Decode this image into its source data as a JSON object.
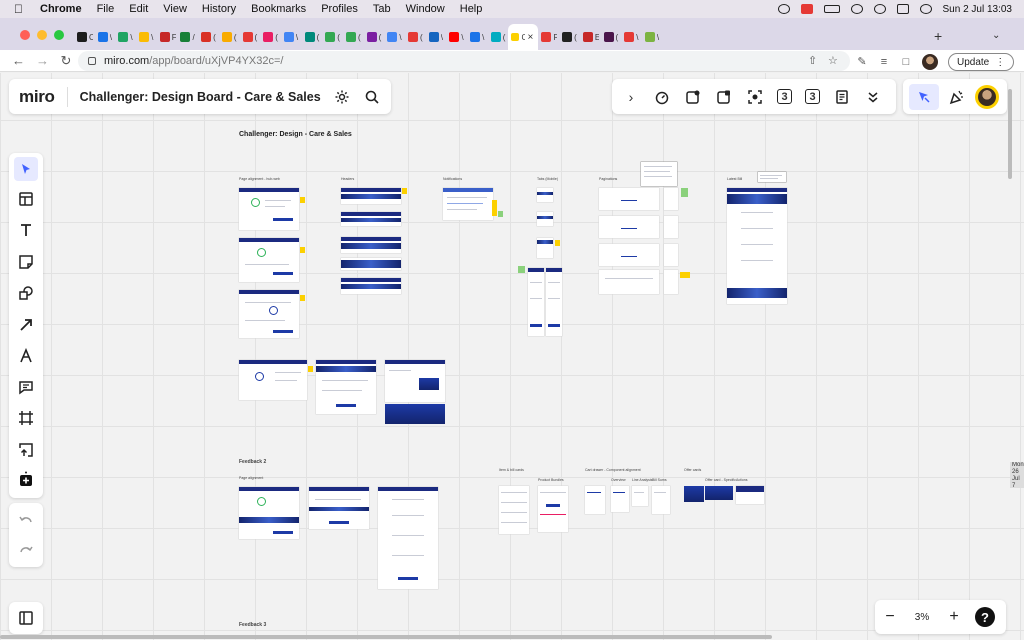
{
  "menubar": {
    "app": "Chrome",
    "items": [
      "File",
      "Edit",
      "View",
      "History",
      "Bookmarks",
      "Profiles",
      "Tab",
      "Window",
      "Help"
    ],
    "datetime": "Sun 2 Jul  13:03"
  },
  "tabs": [
    {
      "label": "O",
      "color": "#1d1d1d"
    },
    {
      "label": "\\",
      "color": "#1a73e8"
    },
    {
      "label": "\\",
      "color": "#1fa463"
    },
    {
      "label": "\\",
      "color": "#fbbc04"
    },
    {
      "label": "F",
      "color": "#c62828"
    },
    {
      "label": "/",
      "color": "#188038"
    },
    {
      "label": "(",
      "color": "#d93025"
    },
    {
      "label": "(",
      "color": "#f9ab00"
    },
    {
      "label": "(",
      "color": "#e53935"
    },
    {
      "label": "(",
      "color": "#e91e63"
    },
    {
      "label": "\\",
      "color": "#4285f4"
    },
    {
      "label": "(",
      "color": "#00897b"
    },
    {
      "label": "(",
      "color": "#34a853"
    },
    {
      "label": "(",
      "color": "#34a853"
    },
    {
      "label": "(",
      "color": "#7b1fa2"
    },
    {
      "label": "\\",
      "color": "#4285f4"
    },
    {
      "label": "(",
      "color": "#e53935"
    },
    {
      "label": "\\",
      "color": "#1565c0"
    },
    {
      "label": "\\",
      "color": "#ff0000"
    },
    {
      "label": "\\",
      "color": "#1a73e8"
    },
    {
      "label": "(",
      "color": "#00acc1"
    },
    {
      "label": "C",
      "color": "#fcd000",
      "active": true
    },
    {
      "label": "F",
      "color": "#e53935"
    },
    {
      "label": "(",
      "color": "#212121"
    },
    {
      "label": "E",
      "color": "#c62828"
    },
    {
      "label": "(",
      "color": "#4a154b"
    },
    {
      "label": "\\",
      "color": "#e53935"
    },
    {
      "label": "\\",
      "color": "#7cb342"
    }
  ],
  "address": {
    "host": "miro.com",
    "path": "/app/board/uXjVP4YX32c=/",
    "update_label": "Update"
  },
  "miro": {
    "logo": "miro",
    "board_name": "Challenger: Design Board - Care & Sales",
    "counter_a": "3",
    "counter_b": "3",
    "zoom": "3%",
    "help": "?"
  },
  "board": {
    "title": "Challenger: Design - Care & Sales",
    "sections": [
      {
        "label": "Page alignment - hub-web"
      },
      {
        "label": "Headers"
      },
      {
        "label": "Notifications"
      },
      {
        "label": "Tabs (Mobile)"
      },
      {
        "label": "Paginations"
      },
      {
        "label": "Latest Bill"
      }
    ],
    "feedback2": "Feedback 2",
    "feedback2_sub": "Page alignment",
    "feedback2_cols": [
      {
        "label": "Item & bill cards"
      },
      {
        "label": "Product Bundles"
      },
      {
        "label": "Cart drawer - Component alignment"
      },
      {
        "label": "Overview"
      },
      {
        "label": "Line Analysis"
      },
      {
        "label": "Bill Sums"
      },
      {
        "label": "Offer cards"
      },
      {
        "label": "Offer card - Specific"
      },
      {
        "label": "Actions"
      }
    ],
    "feedback3": "Feedback 3"
  },
  "side_notification": "Mon 26 Jul 7"
}
